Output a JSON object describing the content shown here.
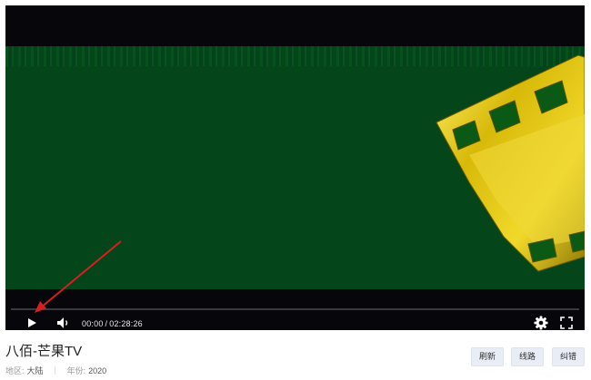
{
  "player": {
    "current_time": "00:00",
    "separator": "/",
    "duration": "02:28:26",
    "progress": 0,
    "icons": [
      "play-icon",
      "volume-icon",
      "gear-icon",
      "fullscreen-icon"
    ]
  },
  "video": {
    "title": "八佰-芒果TV",
    "region_label": "地区:",
    "region_value": "大陆",
    "year_label": "年份:",
    "year_value": "2020"
  },
  "actions": {
    "refresh_label": "刷新",
    "route_label": "线路",
    "error_label": "纠错"
  },
  "colors": {
    "video_background": "#04461a",
    "film_gold": "#d8b90a",
    "annotation_arrow": "#d42020"
  }
}
